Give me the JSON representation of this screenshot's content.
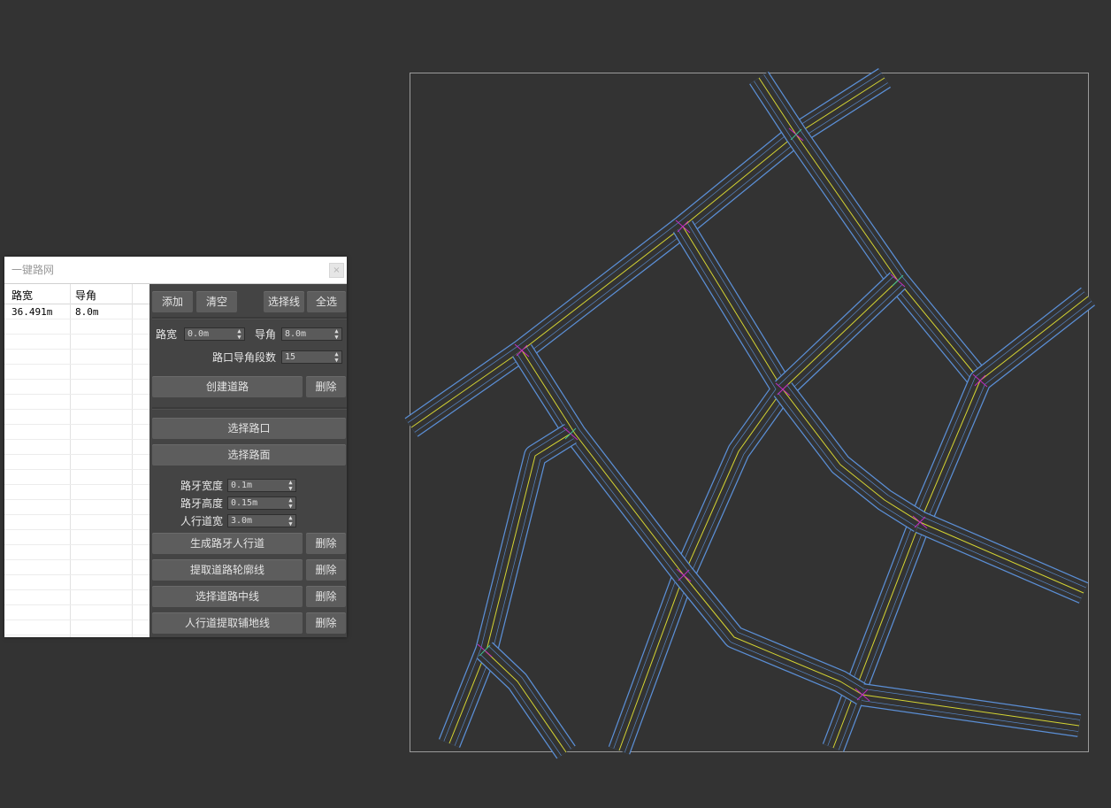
{
  "viewport": {
    "background": "#333333",
    "frame_color": "#9a9a9a"
  },
  "colors": {
    "road_edge": "#5b8fd6",
    "center_line": "#d4d433",
    "junction_mark": "#c02ac0",
    "junction_mark2": "#3fbf8f"
  },
  "dialog": {
    "title": "一键路网",
    "close_label": "×",
    "list": {
      "headers": [
        "路宽",
        "导角"
      ],
      "rows": [
        [
          "36.491m",
          "8.0m"
        ]
      ]
    },
    "buttons": {
      "add": "添加",
      "clear": "清空",
      "select_line": "选择线",
      "select_all": "全选",
      "create_road": "创建道路",
      "delete": "删除",
      "select_junction": "选择路口",
      "select_surface": "选择路面",
      "generate_curb": "生成路牙人行道",
      "extract_outline": "提取道路轮廓线",
      "select_centerline": "选择道路中线",
      "extract_paving": "人行道提取铺地线"
    },
    "fields": {
      "road_width": {
        "label": "路宽",
        "value": "0.0m"
      },
      "chamfer": {
        "label": "导角",
        "value": "8.0m"
      },
      "segments": {
        "label": "路口导角段数",
        "value": "15"
      },
      "curb_width": {
        "label": "路牙宽度",
        "value": "0.1m"
      },
      "curb_height": {
        "label": "路牙高度",
        "value": "0.15m"
      },
      "sidewalk_width": {
        "label": "人行道宽",
        "value": "3.0m"
      }
    }
  }
}
